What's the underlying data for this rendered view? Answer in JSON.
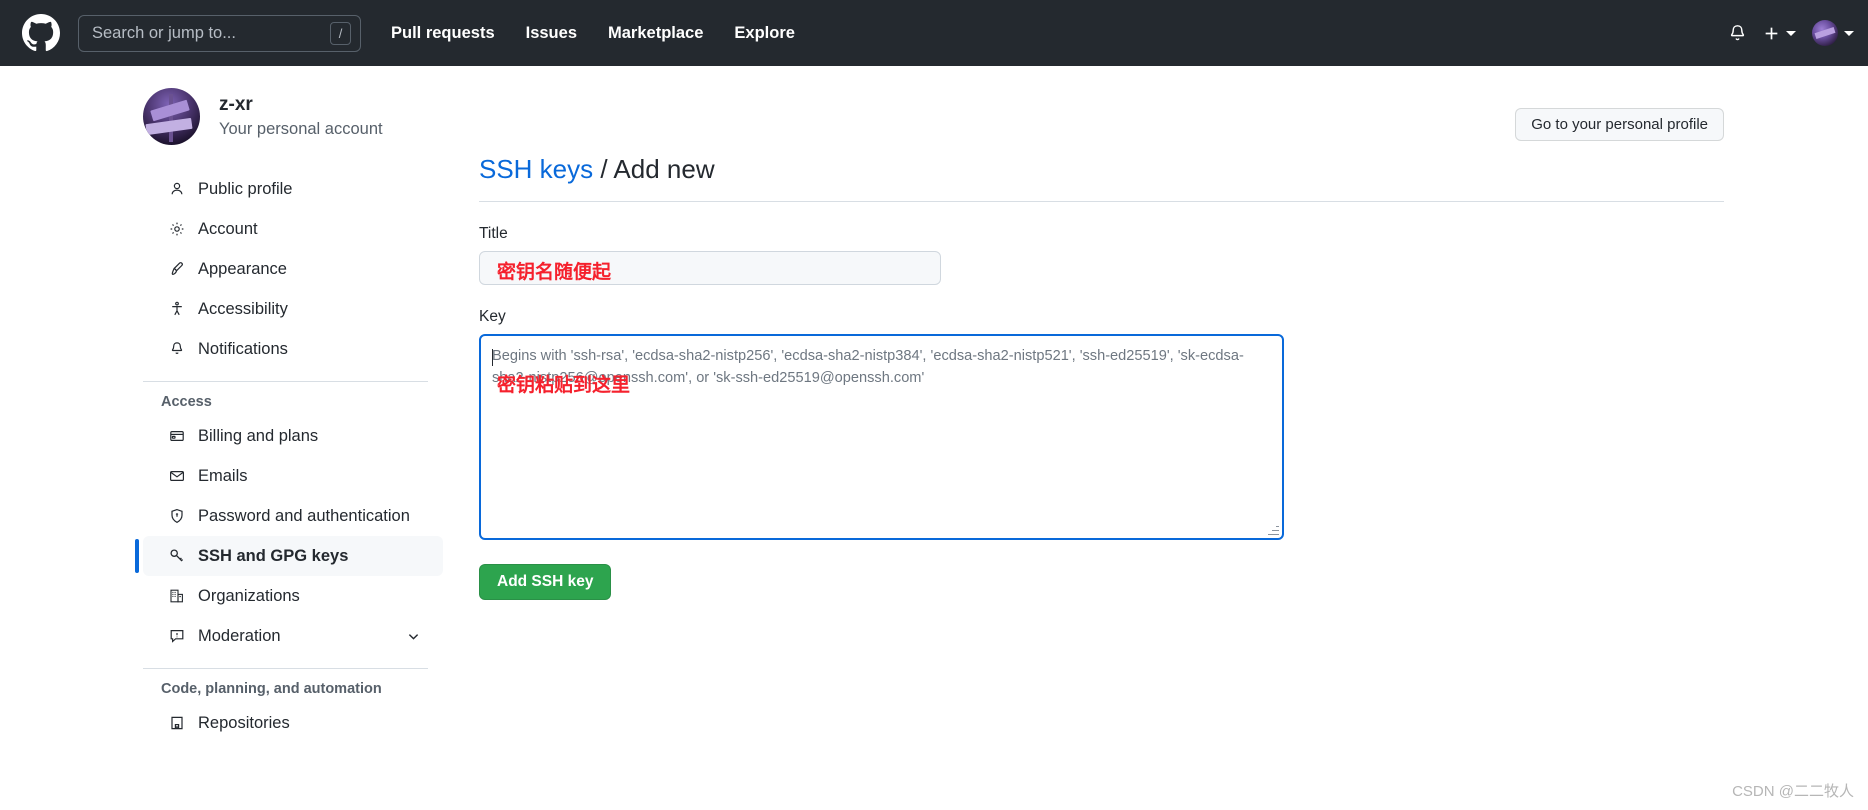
{
  "header": {
    "logo_icon": "github-mark-icon",
    "search": {
      "placeholder": "Search or jump to...",
      "shortcut_key": "/"
    },
    "nav": [
      {
        "label": "Pull requests"
      },
      {
        "label": "Issues"
      },
      {
        "label": "Marketplace"
      },
      {
        "label": "Explore"
      }
    ],
    "right": {
      "notifications_icon": "bell-icon",
      "create_new_icon": "plus-icon",
      "create_new_caret": "chevron-down-icon",
      "avatar_icon": "user-avatar-icon",
      "avatar_caret": "chevron-down-icon"
    },
    "colors": {
      "background": "#24292f",
      "text": "#ffffff"
    }
  },
  "profile": {
    "account_name": "z-xr",
    "account_subtitle": "Your personal account",
    "avatar_icon": "user-avatar-icon",
    "go_to_profile_label": "Go to your personal profile"
  },
  "sidebar": {
    "groups": [
      {
        "heading": "",
        "items": [
          {
            "label": "Public profile",
            "icon": "person-icon",
            "active": false
          },
          {
            "label": "Account",
            "icon": "gear-icon",
            "active": false
          },
          {
            "label": "Appearance",
            "icon": "paintbrush-icon",
            "active": false
          },
          {
            "label": "Accessibility",
            "icon": "accessibility-icon",
            "active": false
          },
          {
            "label": "Notifications",
            "icon": "bell-icon",
            "active": false
          }
        ]
      },
      {
        "heading": "Access",
        "items": [
          {
            "label": "Billing and plans",
            "icon": "credit-card-icon",
            "active": false
          },
          {
            "label": "Emails",
            "icon": "mail-icon",
            "active": false
          },
          {
            "label": "Password and authentication",
            "icon": "shield-lock-icon",
            "active": false
          },
          {
            "label": "SSH and GPG keys",
            "icon": "key-icon",
            "active": true
          },
          {
            "label": "Organizations",
            "icon": "organization-icon",
            "active": false
          },
          {
            "label": "Moderation",
            "icon": "report-icon",
            "active": false,
            "expand_icon": "chevron-down-icon"
          }
        ]
      },
      {
        "heading": "Code, planning, and automation",
        "items": [
          {
            "label": "Repositories",
            "icon": "repo-icon",
            "active": false
          }
        ]
      }
    ],
    "active_marker_color": "#0969da"
  },
  "main": {
    "breadcrumb_link": "SSH keys",
    "breadcrumb_separator": "/",
    "breadcrumb_current": "Add new",
    "title_field": {
      "label": "Title",
      "value": "",
      "annotation": "密钥名随便起"
    },
    "key_field": {
      "label": "Key",
      "value": "",
      "placeholder_line1": "Begins with 'ssh-rsa', 'ecdsa-sha2-nistp256', 'ecdsa-sha2-nistp384', 'ecdsa-sha2-nistp521', 'ssh-ed25519', 'sk-ecdsa-",
      "placeholder_line2": "sha2-nistp256@openssh.com', or 'sk-ssh-ed25519@openssh.com'",
      "annotation": "密钥粘贴到这里",
      "focus_border_color": "#0969da"
    },
    "submit_label": "Add SSH key",
    "submit_color": "#2da44e",
    "annotation_color": "#f5212d"
  },
  "watermark": "CSDN @二二牧人"
}
